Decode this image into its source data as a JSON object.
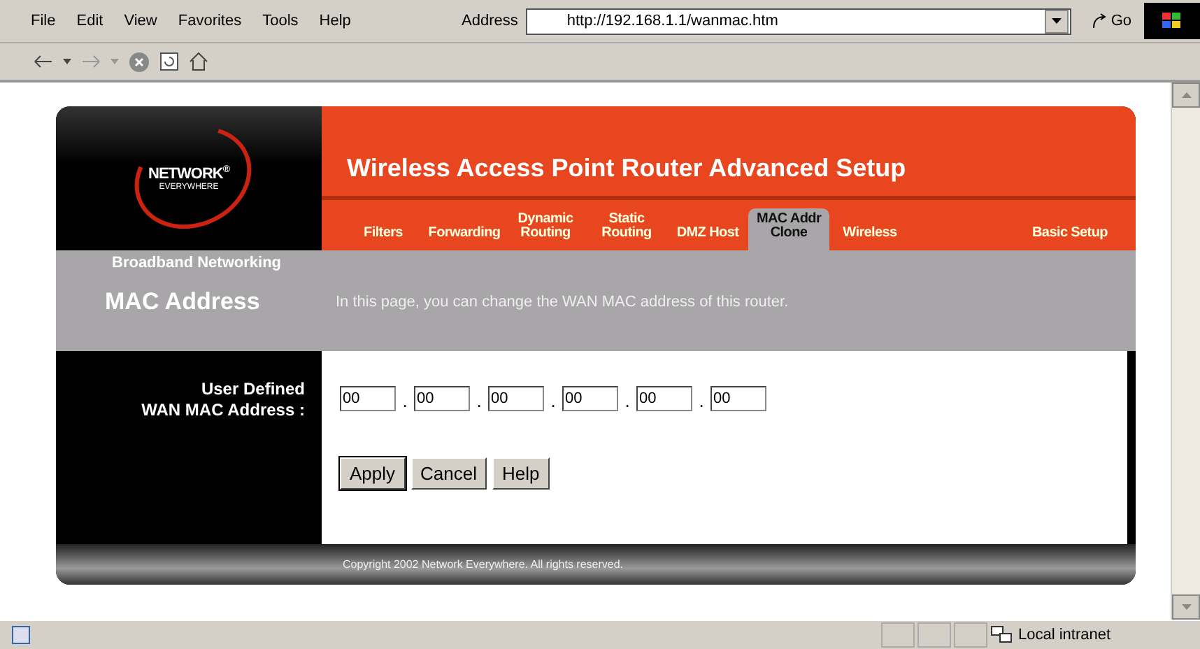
{
  "menu": [
    "File",
    "Edit",
    "View",
    "Favorites",
    "Tools",
    "Help"
  ],
  "address": {
    "label": "Address",
    "value": "http://192.168.1.1/wanmac.htm",
    "go": "Go"
  },
  "router": {
    "logo": {
      "line1": "NETWORK",
      "line2": "EVERYWHERE",
      "mark": "®"
    },
    "title": "Wireless Access Point Router Advanced Setup",
    "tabs": [
      {
        "label": "Filters",
        "selected": false
      },
      {
        "label": "Forwarding",
        "selected": false
      },
      {
        "label": "Dynamic Routing",
        "selected": false
      },
      {
        "label": "Static Routing",
        "selected": false
      },
      {
        "label": "DMZ Host",
        "selected": false
      },
      {
        "label": "MAC Addr Clone",
        "selected": true
      },
      {
        "label": "Wireless",
        "selected": false
      },
      {
        "label": "Basic Setup",
        "selected": false
      }
    ],
    "section": "Broadband Networking",
    "page_title": "MAC Address",
    "description": "In this page, you can change the WAN MAC address of this router.",
    "field_label": [
      "User Defined",
      "WAN MAC Address :"
    ],
    "mac_fields": [
      "00",
      "00",
      "00",
      "00",
      "00",
      "00"
    ],
    "separator": ".",
    "buttons": [
      "Apply",
      "Cancel",
      "Help"
    ],
    "copyright": "Copyright 2002 Network Everywhere. All rights reserved."
  },
  "status_bar": {
    "zone": "Local intranet"
  }
}
